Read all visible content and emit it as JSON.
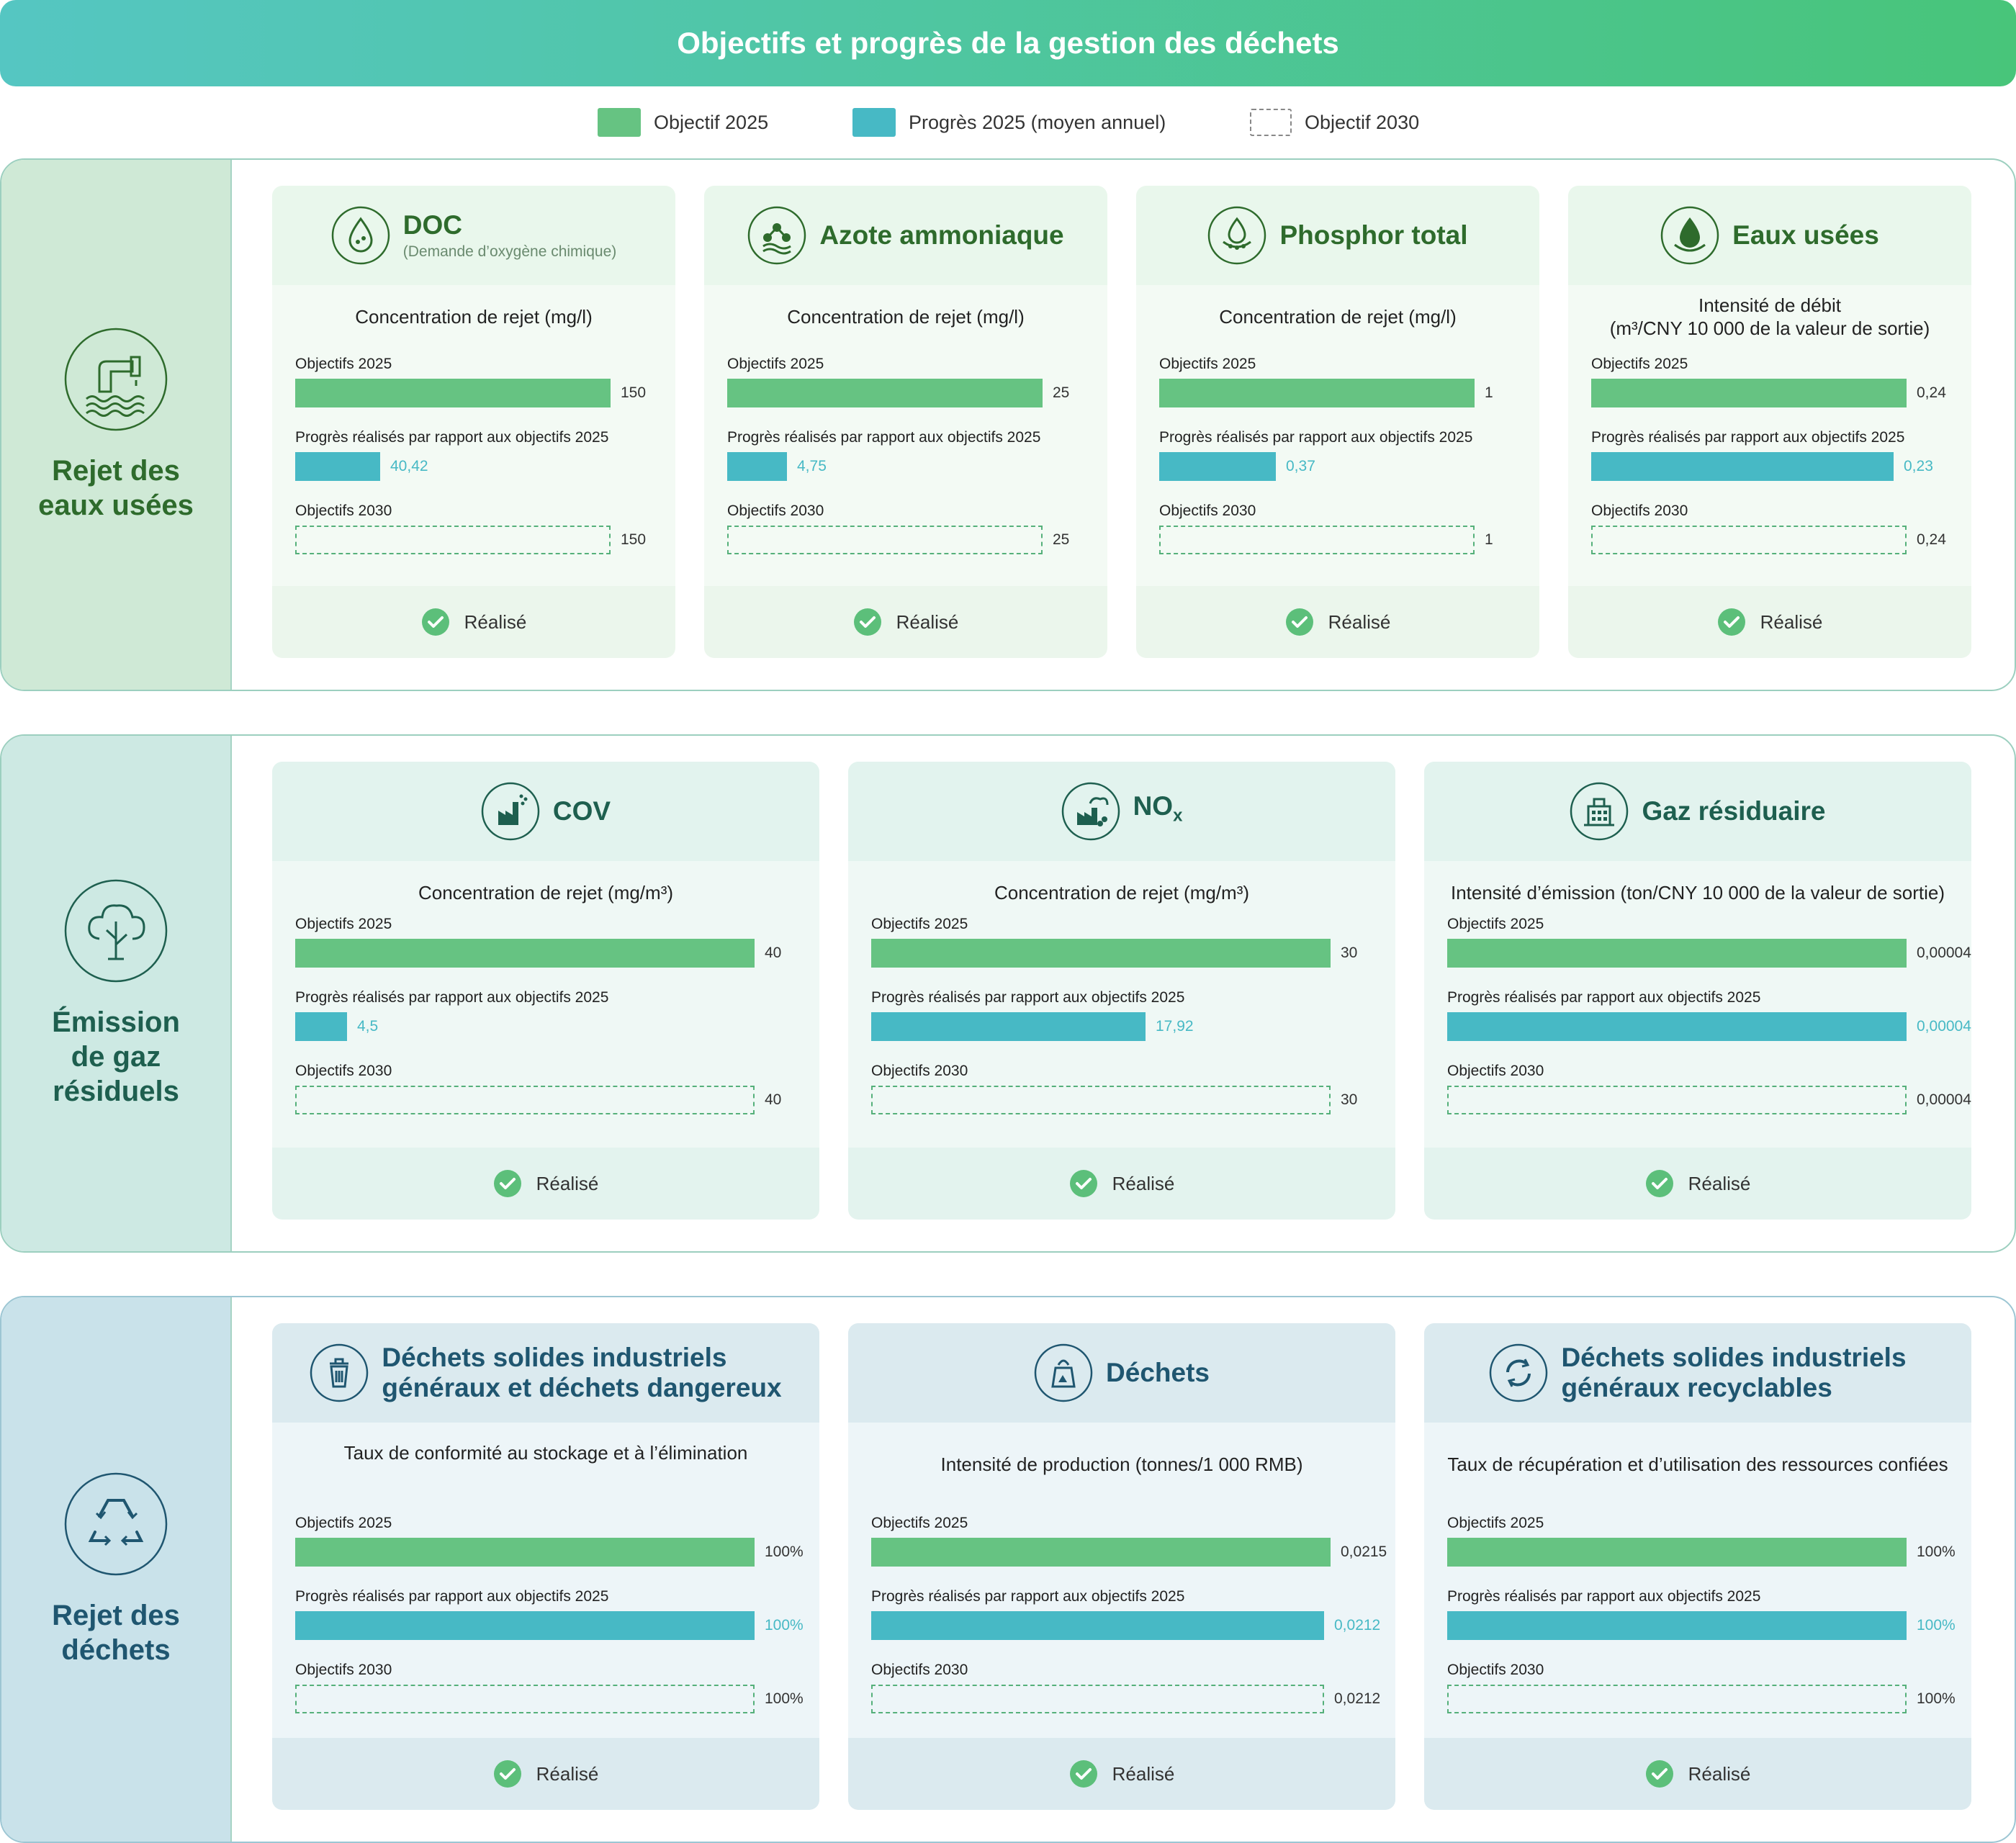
{
  "title": "Objectifs et progrès de la gestion des déchets",
  "legend": [
    {
      "label": "Objectif 2025",
      "style": "solid-green"
    },
    {
      "label": "Progrès 2025 (moyen annuel)",
      "style": "solid-teal"
    },
    {
      "label": "Objectif 2030",
      "style": "dashed"
    }
  ],
  "colors": {
    "target_2025": "#66c382",
    "progress_2025": "#47b9c5",
    "target_2030_border": "#55b07a",
    "status_check": "#5cbf7a"
  },
  "row_labels": {
    "target_2025": "Objectifs 2025",
    "progress": "Progrès réalisés par rapport aux objectifs 2025",
    "target_2030": "Objectifs 2030"
  },
  "status_label": "Réalisé",
  "chart_data": [
    {
      "type": "bar",
      "section": "Rejet des eaux usées",
      "title": "DOC",
      "subtitle": "(Demande d’oxygène chimique)",
      "metric": "Concentration de rejet (mg/l)",
      "values": {
        "target_2025": 150,
        "progress_2025": 40.42,
        "target_2030": 150
      },
      "labels": {
        "target_2025": "150",
        "progress_2025": "40,42",
        "target_2030": "150"
      },
      "status": "Réalisé"
    },
    {
      "type": "bar",
      "section": "Rejet des eaux usées",
      "title": "Azote ammoniaque",
      "metric": "Concentration de rejet (mg/l)",
      "values": {
        "target_2025": 25,
        "progress_2025": 4.75,
        "target_2030": 25
      },
      "labels": {
        "target_2025": "25",
        "progress_2025": "4,75",
        "target_2030": "25"
      },
      "status": "Réalisé"
    },
    {
      "type": "bar",
      "section": "Rejet des eaux usées",
      "title": "Phosphor total",
      "metric": "Concentration de rejet (mg/l)",
      "values": {
        "target_2025": 1,
        "progress_2025": 0.37,
        "target_2030": 1
      },
      "labels": {
        "target_2025": "1",
        "progress_2025": "0,37",
        "target_2030": "1"
      },
      "status": "Réalisé"
    },
    {
      "type": "bar",
      "section": "Rejet des eaux usées",
      "title": "Eaux usées",
      "metric": "Intensité de débit\n(m³/CNY 10 000 de la valeur de sortie)",
      "values": {
        "target_2025": 0.24,
        "progress_2025": 0.23,
        "target_2030": 0.24
      },
      "labels": {
        "target_2025": "0,24",
        "progress_2025": "0,23",
        "target_2030": "0,24"
      },
      "status": "Réalisé"
    },
    {
      "type": "bar",
      "section": "Émission de gaz résiduels",
      "title": "COV",
      "metric": "Concentration de rejet (mg/m³)",
      "values": {
        "target_2025": 40,
        "progress_2025": 4.5,
        "target_2030": 40
      },
      "labels": {
        "target_2025": "40",
        "progress_2025": "4,5",
        "target_2030": "40"
      },
      "status": "Réalisé"
    },
    {
      "type": "bar",
      "section": "Émission de gaz résiduels",
      "title": "NO",
      "title_sub": "x",
      "metric": "Concentration de rejet (mg/m³)",
      "values": {
        "target_2025": 30,
        "progress_2025": 17.92,
        "target_2030": 30
      },
      "labels": {
        "target_2025": "30",
        "progress_2025": "17,92",
        "target_2030": "30"
      },
      "status": "Réalisé"
    },
    {
      "type": "bar",
      "section": "Émission de gaz résiduels",
      "title": "Gaz résiduaire",
      "metric": "Intensité d’émission (ton/CNY 10 000 de la valeur de sortie)",
      "values": {
        "target_2025": 4e-05,
        "progress_2025": 4e-05,
        "target_2030": 4e-05
      },
      "labels": {
        "target_2025": "0,00004",
        "progress_2025": "0,00004",
        "target_2030": "0,00004"
      },
      "status": "Réalisé"
    },
    {
      "type": "bar",
      "section": "Rejet des déchets",
      "title": "Déchets solides industriels\ngénéraux et déchets dangereux",
      "metric": "Taux de conformité au stockage et à l’élimination",
      "values": {
        "target_2025": 100,
        "progress_2025": 100,
        "target_2030": 100
      },
      "labels": {
        "target_2025": "100%",
        "progress_2025": "100%",
        "target_2030": "100%"
      },
      "status": "Réalisé"
    },
    {
      "type": "bar",
      "section": "Rejet des déchets",
      "title": "Déchets",
      "metric": "Intensité de production (tonnes/1 000 RMB)",
      "values": {
        "target_2025": 0.0215,
        "progress_2025": 0.0212,
        "target_2030": 0.0212
      },
      "labels": {
        "target_2025": "0,0215",
        "progress_2025": "0,0212",
        "target_2030": "0,0212"
      },
      "status": "Réalisé"
    },
    {
      "type": "bar",
      "section": "Rejet des déchets",
      "title": "Déchets solides industriels\ngénéraux recyclables",
      "metric": "Taux de récupération et d’utilisation des ressources confiées",
      "values": {
        "target_2025": 100,
        "progress_2025": 100,
        "target_2030": 100
      },
      "labels": {
        "target_2025": "100%",
        "progress_2025": "100%",
        "target_2030": "100%"
      },
      "status": "Réalisé"
    }
  ],
  "sections": [
    {
      "label": "Rejet des\neaux usées",
      "icon": "pipe-water-icon",
      "accent": "#2e6b2c",
      "side_bg": "#cfe9d6",
      "card_head_bg": "#e9f7ec",
      "card_body_bg": "#f3faf4",
      "card_foot_bg": "#ebf6ec"
    },
    {
      "label": "Émission\nde gaz\nrésiduels",
      "icon": "cloud-tree-icon",
      "accent": "#1e5f4f",
      "side_bg": "#cde9e3",
      "card_head_bg": "#e2f3ee",
      "card_body_bg": "#eff8f5",
      "card_foot_bg": "#e3f3ee"
    },
    {
      "label": "Rejet des\ndéchets",
      "icon": "recycle-icon",
      "accent": "#1f5670",
      "side_bg": "#c9e2ea",
      "card_head_bg": "#dbeaef",
      "card_body_bg": "#edf5f8",
      "card_foot_bg": "#dbeaef"
    }
  ]
}
